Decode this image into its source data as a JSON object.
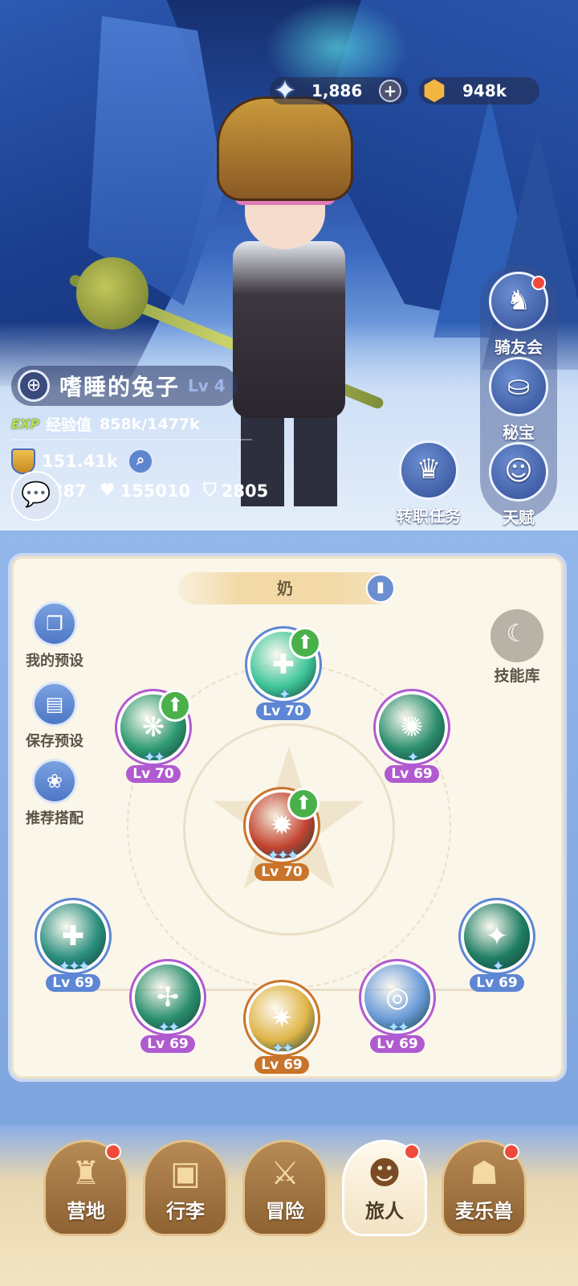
{
  "currency": {
    "star_icon": "star-crystal-icon",
    "star_amount": "1,886",
    "plus": "+",
    "gold_icon": "gold-coin-icon",
    "gold_amount": "948k"
  },
  "player": {
    "name": "嗜睡的兔子",
    "level": "Lv 4",
    "exp_tag": "EXP",
    "exp_label": "经验值",
    "exp_value": "858k/1477k",
    "power": "151.41k",
    "stat_attack": "387",
    "stat_hp": "155010",
    "stat_def": "2805"
  },
  "side_menu": [
    {
      "label": "骑友会",
      "icon": "horse-icon",
      "badge": true
    },
    {
      "label": "秘宝",
      "icon": "treasure-icon",
      "badge": false
    },
    {
      "label": "天赋",
      "icon": "talent-head-icon",
      "badge": false
    }
  ],
  "job_quest": {
    "label": "转职任务",
    "icon": "crown-icon"
  },
  "skill_panel": {
    "title": "奶",
    "left_buttons": [
      {
        "label": "我的预设",
        "icon": "preset-card-icon"
      },
      {
        "label": "保存预设",
        "icon": "save-icon"
      },
      {
        "label": "推荐搭配",
        "icon": "recommend-icon"
      }
    ],
    "library_label": "技能库",
    "skills": [
      {
        "level": "Lv 70",
        "stars": "✦",
        "upgrade": true,
        "ring": "#5d86d4",
        "fill": "#3fc69a"
      },
      {
        "level": "Lv 70",
        "stars": "✦✦",
        "upgrade": true,
        "ring": "#b05ad0",
        "fill": "#2e9b72"
      },
      {
        "level": "Lv 69",
        "stars": "✦",
        "upgrade": false,
        "ring": "#b05ad0",
        "fill": "#2b8f6e"
      },
      {
        "level": "Lv 70",
        "stars": "✦✦✦",
        "upgrade": true,
        "ring": "#c9742a",
        "fill": "#c2442f"
      },
      {
        "level": "Lv 69",
        "stars": "✦✦✦",
        "upgrade": false,
        "ring": "#5d86d4",
        "fill": "#2b8f7e"
      },
      {
        "level": "Lv 69",
        "stars": "✦✦",
        "upgrade": false,
        "ring": "#b05ad0",
        "fill": "#2b8f6e"
      },
      {
        "level": "Lv 69",
        "stars": "✦✦",
        "upgrade": false,
        "ring": "#c9742a",
        "fill": "#e0b548"
      },
      {
        "level": "Lv 69",
        "stars": "✦✦",
        "upgrade": false,
        "ring": "#b05ad0",
        "fill": "#6a9bd8"
      },
      {
        "level": "Lv 69",
        "stars": "✦",
        "upgrade": false,
        "ring": "#5d86d4",
        "fill": "#1f7e63"
      }
    ]
  },
  "bottom_nav": [
    {
      "label": "营地",
      "icon": "castle-icon",
      "badge": true,
      "active": false
    },
    {
      "label": "行李",
      "icon": "backpack-icon",
      "badge": false,
      "active": false
    },
    {
      "label": "冒险",
      "icon": "crossed-swords-icon",
      "badge": false,
      "active": false
    },
    {
      "label": "旅人",
      "icon": "traveler-avatar-icon",
      "badge": true,
      "active": true
    },
    {
      "label": "麦乐兽",
      "icon": "pet-cat-icon",
      "badge": true,
      "active": false
    }
  ]
}
